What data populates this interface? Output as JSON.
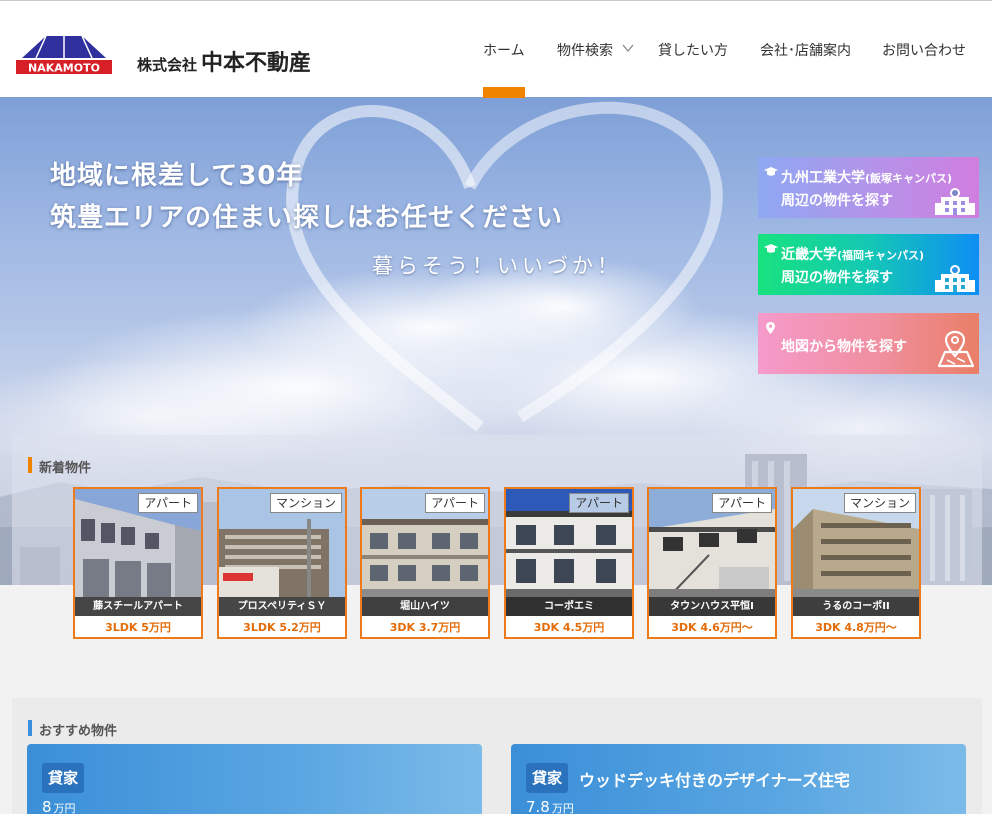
{
  "brand": {
    "logo_text": "NAKAMOTO",
    "company_prefix": "株式会社",
    "company_name": "中本不動産"
  },
  "nav": {
    "items": [
      "ホーム",
      "物件検索",
      "貸したい方",
      "会社･店舗案内",
      "お問い合わせ"
    ],
    "active_index": 0,
    "accent": "#f08300"
  },
  "hero": {
    "headline_1": "地域に根差して30年",
    "headline_2": "筑豊エリアの住まい探しはお任せください",
    "tagline": "暮らそう！いいづか！"
  },
  "side_buttons": {
    "kyushu": {
      "title": "九州工業大学",
      "campus": "(飯塚キャンパス)",
      "action": "周辺の物件を探す"
    },
    "kindai": {
      "title": "近畿大学",
      "campus": "(福岡キャンパス)",
      "action": "周辺の物件を探す"
    },
    "map": {
      "label": "地図から物件を探す"
    }
  },
  "new_listings": {
    "heading": "新着物件",
    "items": [
      {
        "type": "アパート",
        "name": "藤スチールアパート",
        "price": "3LDK 5万円"
      },
      {
        "type": "マンション",
        "name": "プロスペリティＳＹ",
        "price": "3LDK 5.2万円"
      },
      {
        "type": "アパート",
        "name": "堀山ハイツ",
        "price": "3DK 3.7万円"
      },
      {
        "type": "アパート",
        "name": "コーポエミ",
        "price": "3DK 4.5万円"
      },
      {
        "type": "アパート",
        "name": "タウンハウス平恒Ⅰ",
        "price": "3DK 4.6万円～"
      },
      {
        "type": "マンション",
        "name": "うるのコーポII",
        "price": "3DK 4.8万円～"
      }
    ]
  },
  "recommended": {
    "heading": "おすすめ物件",
    "items": [
      {
        "badge": "貸家",
        "title": "",
        "price": "8",
        "unit": "万円"
      },
      {
        "badge": "貸家",
        "title": "ウッドデッキ付きのデザイナーズ住宅",
        "price": "7.8",
        "unit": "万円"
      }
    ]
  }
}
